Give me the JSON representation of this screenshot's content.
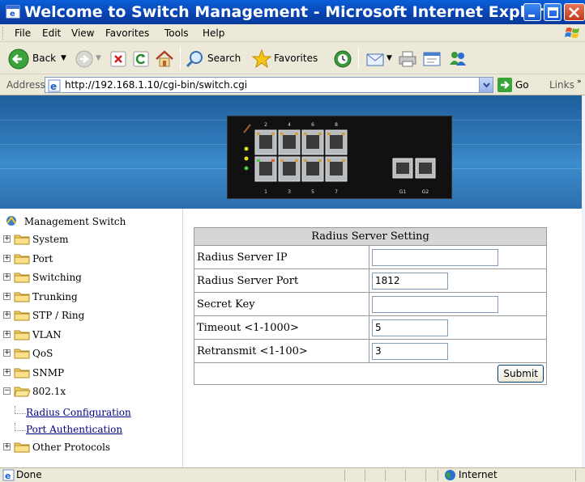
{
  "window": {
    "title": "Welcome to Switch Management - Microsoft Internet Explorer"
  },
  "menu": {
    "items": [
      "File",
      "Edit",
      "View",
      "Favorites",
      "Tools",
      "Help"
    ]
  },
  "toolbar": {
    "back_label": "Back",
    "search_label": "Search",
    "favorites_label": "Favorites"
  },
  "address": {
    "label": "Address",
    "url": "http://192.168.1.10/cgi-bin/switch.cgi",
    "go_label": "Go",
    "links_label": "Links"
  },
  "nav": {
    "root_label": "Management Switch",
    "items": [
      {
        "label": "System",
        "toggle": "+"
      },
      {
        "label": "Port",
        "toggle": "+"
      },
      {
        "label": "Switching",
        "toggle": "+"
      },
      {
        "label": "Trunking",
        "toggle": "+"
      },
      {
        "label": "STP / Ring",
        "toggle": "+"
      },
      {
        "label": "VLAN",
        "toggle": "+"
      },
      {
        "label": "QoS",
        "toggle": "+"
      },
      {
        "label": "SNMP",
        "toggle": "+"
      },
      {
        "label": "802.1x",
        "toggle": "−"
      }
    ],
    "sub_items": [
      "Radius Configuration",
      "Port Authentication"
    ],
    "last_item": {
      "label": "Other Protocols",
      "toggle": "+"
    }
  },
  "radius_form": {
    "heading": "Radius Server Setting",
    "rows": [
      {
        "label": "Radius Server IP",
        "value": ""
      },
      {
        "label": "Radius Server Port",
        "value": "1812"
      },
      {
        "label": "Secret Key",
        "value": ""
      },
      {
        "label": "Timeout <1-1000>",
        "value": "5"
      },
      {
        "label": "Retransmit <1-100>",
        "value": "3"
      }
    ],
    "submit_label": "Submit"
  },
  "status": {
    "text": "Done",
    "zone": "Internet"
  },
  "switch_image": {
    "port_labels_top": [
      "2",
      "4",
      "6",
      "8"
    ],
    "port_labels_bottom": [
      "1",
      "3",
      "5",
      "7",
      "G1",
      "G2"
    ]
  }
}
